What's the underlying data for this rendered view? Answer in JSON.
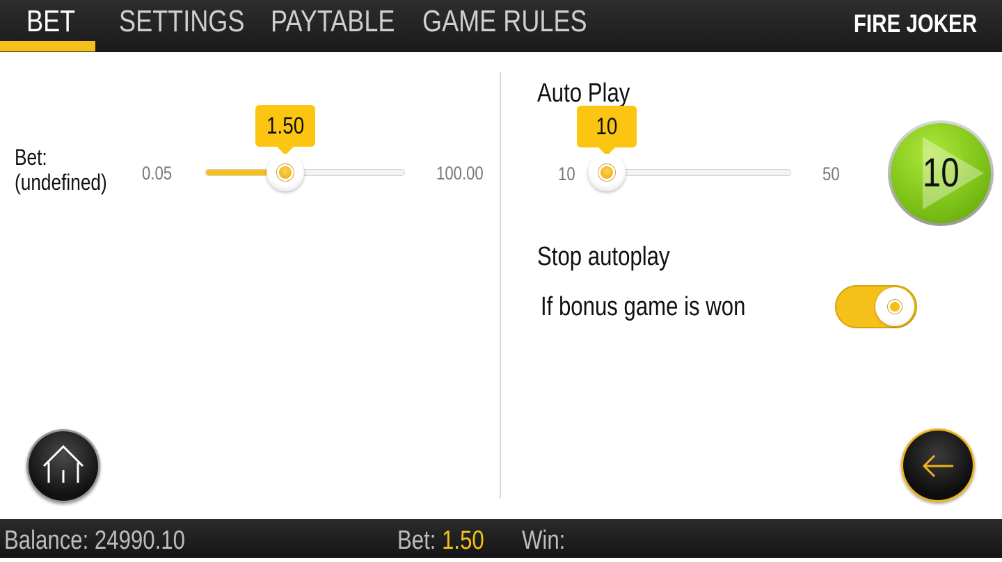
{
  "nav": {
    "tabs": [
      {
        "label": "BET"
      },
      {
        "label": "SETTINGS"
      },
      {
        "label": "PAYTABLE"
      },
      {
        "label": "GAME RULES"
      }
    ],
    "active_tab": "BET",
    "game_title": "FIRE JOKER"
  },
  "bet": {
    "label_line1": "Bet:",
    "label_line2": "(undefined)",
    "min": "0.05",
    "max": "100.00",
    "value": "1.50",
    "slider_fraction": 0.4
  },
  "autoplay": {
    "title": "Auto Play",
    "min": "10",
    "max": "50",
    "value": "10",
    "slider_fraction": 0.0,
    "play_button_count": "10",
    "stop_title": "Stop autoplay",
    "stop_condition_label": "If bonus game is won",
    "stop_condition_enabled": true
  },
  "footer": {
    "balance_label": "Balance:",
    "balance_value": "24990.10",
    "bet_label": "Bet:",
    "bet_value": "1.50",
    "win_label": "Win:",
    "win_value": ""
  },
  "colors": {
    "accent": "#f5c01a",
    "play_green": "#7cc117",
    "topbar": "#222222"
  },
  "icons": {
    "home": "home-icon",
    "back": "arrow-left-icon",
    "play": "play-icon"
  }
}
